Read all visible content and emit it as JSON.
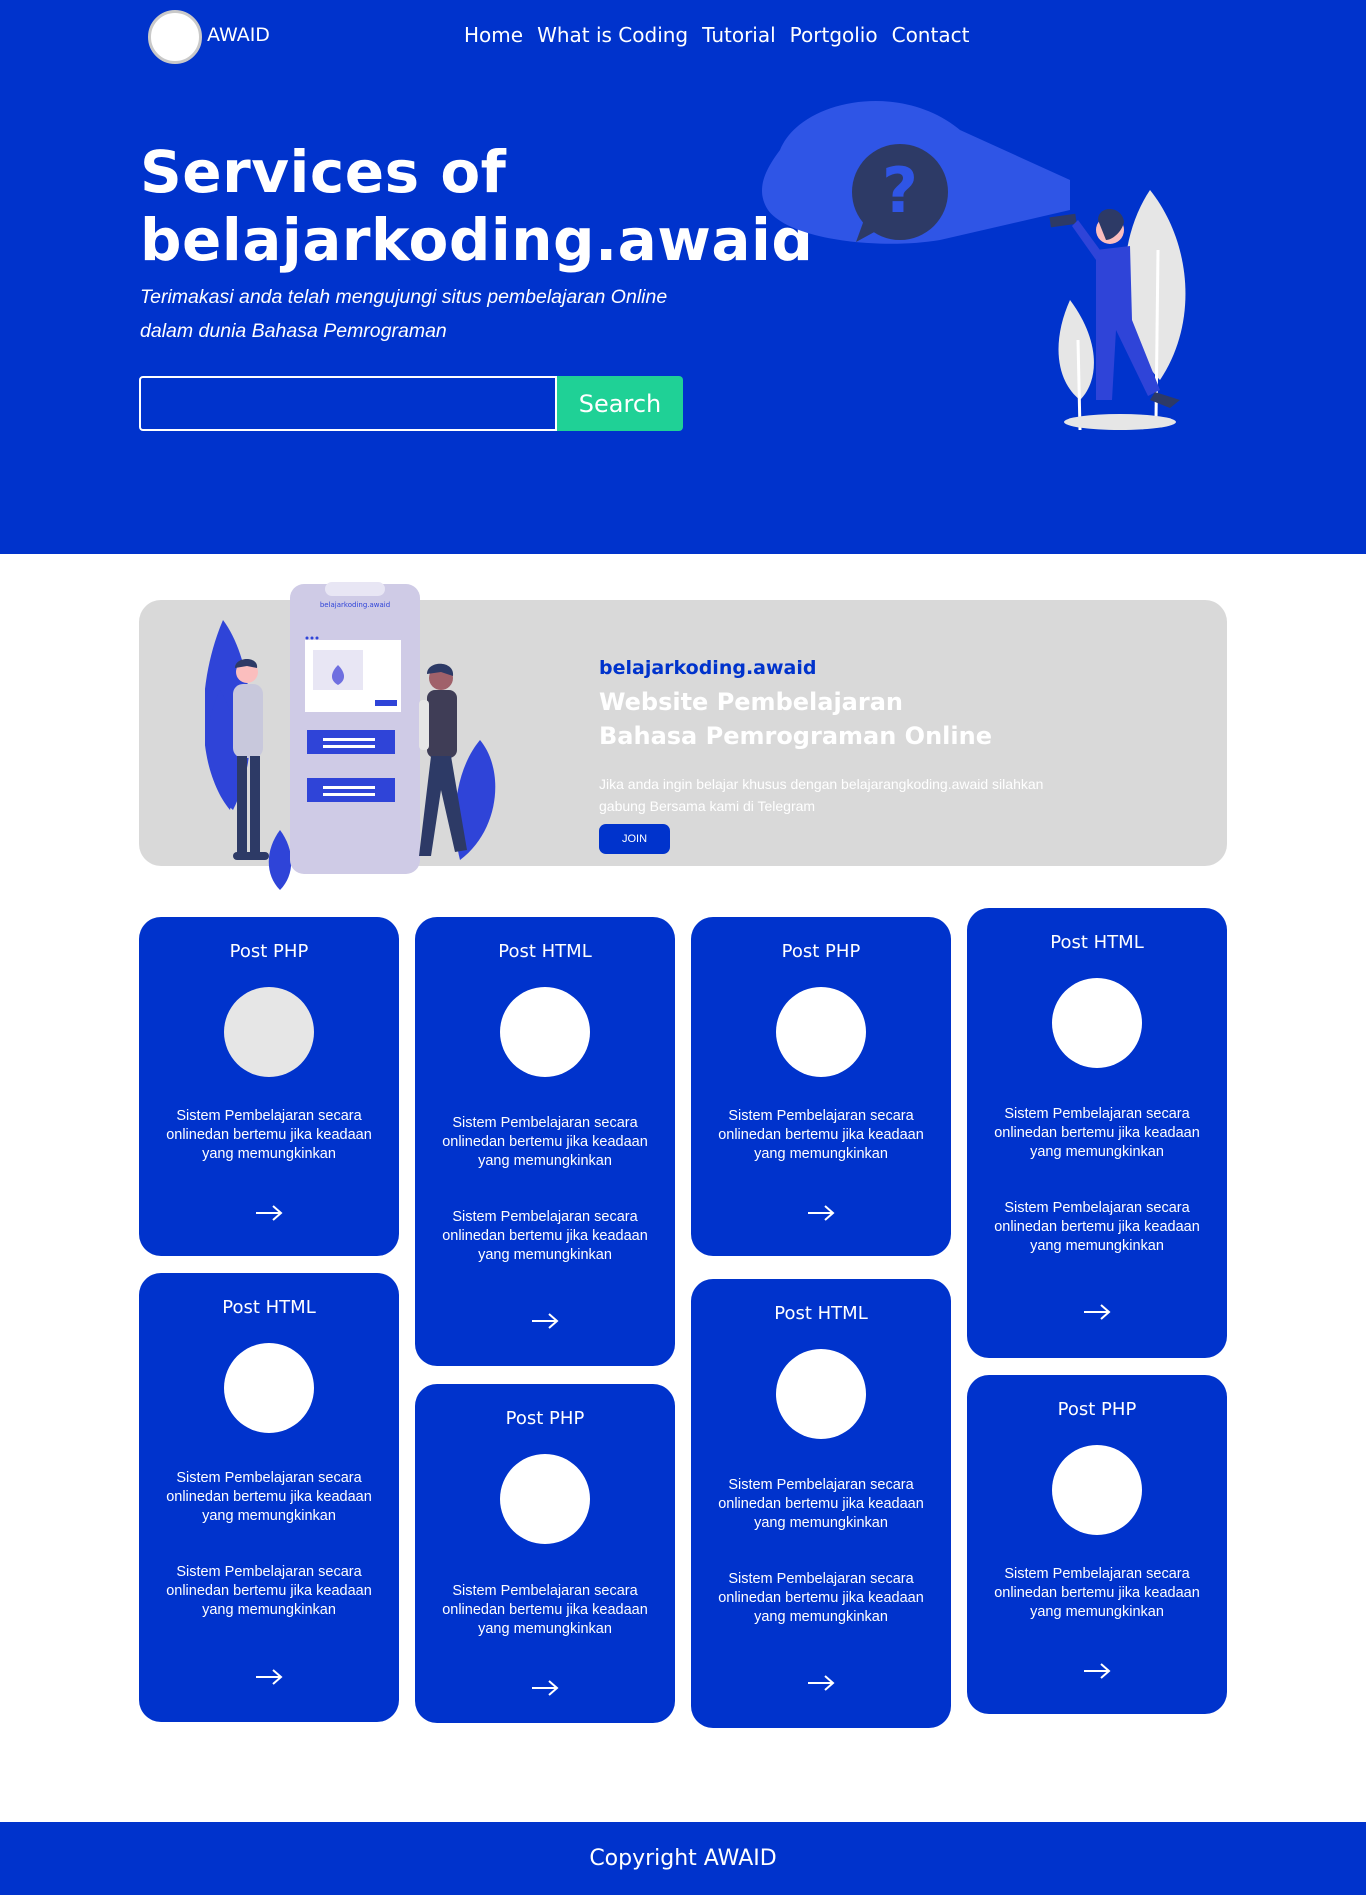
{
  "nav": {
    "brand": "AWAID",
    "items": [
      "Home",
      "What is Coding",
      "Tutorial",
      "Portgolio",
      "Contact"
    ]
  },
  "hero": {
    "title": "Services of belajarkoding.awaid",
    "subtitle": "Terimakasi anda telah mengujungi situs pembelajaran Online dalam dunia Bahasa Pemrograman",
    "search_value": "",
    "search_button": "Search"
  },
  "banner": {
    "tag": "belajarkoding.awaid",
    "heading_line1": "Website Pembelajaran",
    "heading_line2": "Bahasa Pemrograman Online",
    "text": "Jika anda ingin belajar khusus dengan belajarangkoding.awaid silahkan gabung Bersama kami di Telegram",
    "join_button": "JOIN",
    "phone_label": "belajarkoding.awaid"
  },
  "cards": [
    {
      "title": "Post PHP",
      "text": "Sistem Pembelajaran secara onlinedan bertemu jika keadaan yang memungkinkan"
    },
    {
      "title": "Post HTML",
      "text": "Sistem Pembelajaran secara onlinedan bertemu jika keadaan yang memungkinkan"
    },
    {
      "title": "Post PHP",
      "text": "Sistem Pembelajaran secara onlinedan bertemu jika keadaan yang memungkinkan"
    },
    {
      "title": "Post HTML",
      "text": "Sistem Pembelajaran secara onlinedan bertemu jika keadaan yang memungkinkan"
    },
    {
      "title": "Post HTML",
      "text": "Sistem Pembelajaran secara onlinedan bertemu jika keadaan yang memungkinkan"
    },
    {
      "title": "Post PHP",
      "text": "Sistem Pembelajaran secara onlinedan bertemu jika keadaan yang memungkinkan"
    },
    {
      "title": "Post HTML",
      "text": "Sistem Pembelajaran secara onlinedan bertemu jika keadaan yang memungkinkan"
    },
    {
      "title": "Post PHP",
      "text": "Sistem Pembelajaran secara onlinedan bertemu jika keadaan yang memungkinkan"
    }
  ],
  "footer": {
    "copyright": "Copyright AWAID"
  },
  "colors": {
    "primary": "#0033cc",
    "accent": "#1fd196",
    "banner_bg": "#d9d9d9"
  },
  "icons": [
    "arrow-right-icon"
  ]
}
